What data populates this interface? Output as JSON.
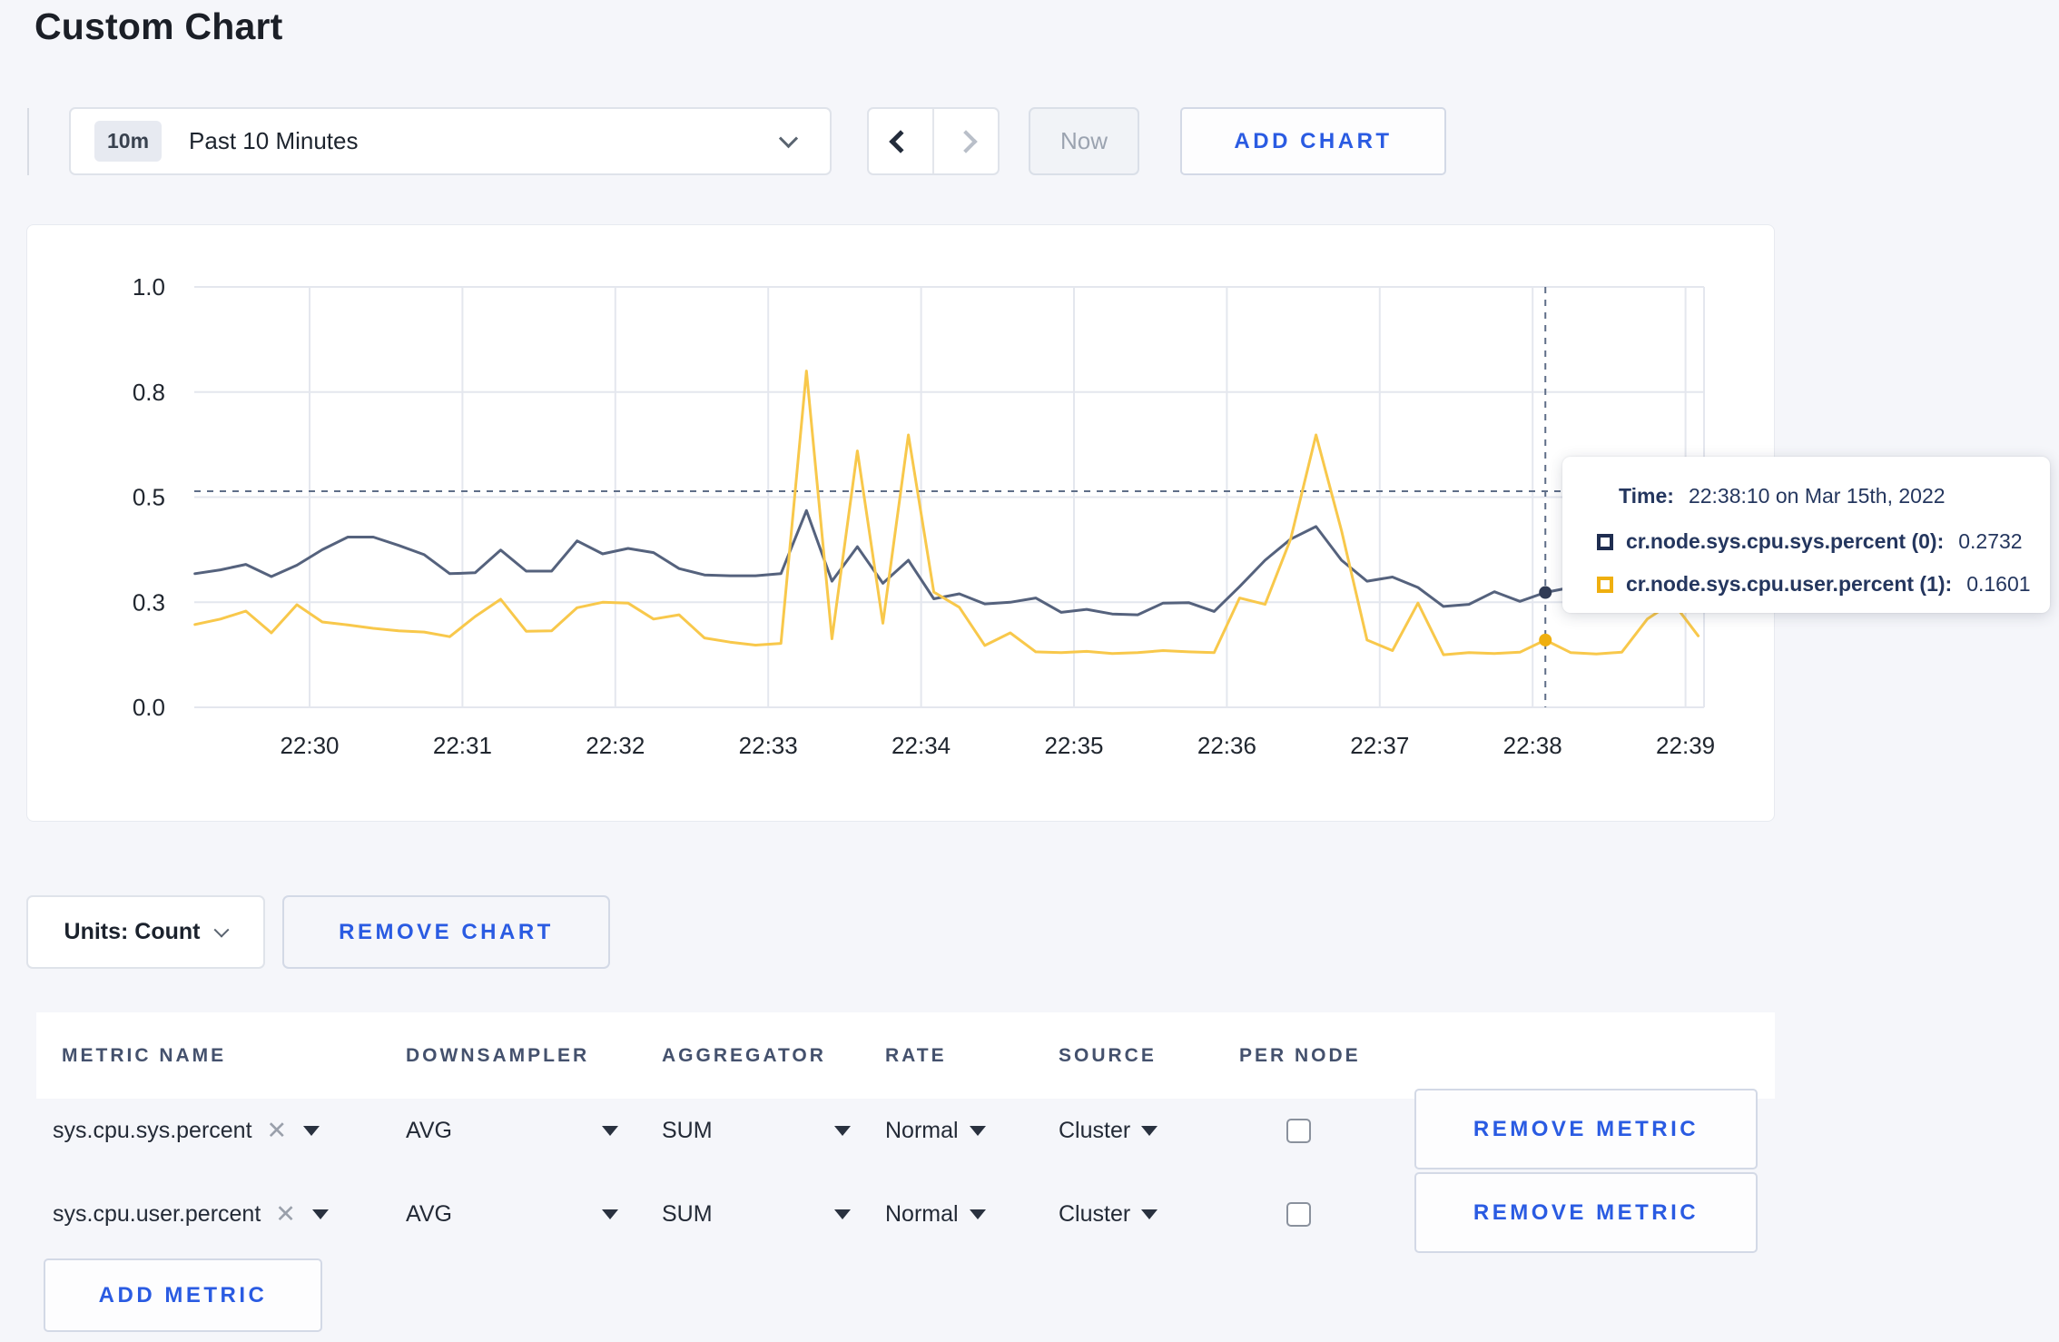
{
  "page": {
    "title": "Custom Chart"
  },
  "toolbar": {
    "time_window_badge": "10m",
    "time_window_label": "Past 10 Minutes",
    "prev_label": "previous time window",
    "next_label": "next time window",
    "now_label": "Now",
    "add_chart_label": "ADD CHART"
  },
  "chart_controls": {
    "units_label": "Units: Count",
    "remove_chart_label": "REMOVE CHART"
  },
  "tooltip": {
    "time_label": "Time:",
    "time_value": "22:38:10 on Mar 15th, 2022",
    "series": [
      {
        "name": "cr.node.sys.cpu.sys.percent (0):",
        "value": "0.2732",
        "color": "#1f2d50"
      },
      {
        "name": "cr.node.sys.cpu.user.percent (1):",
        "value": "0.1601",
        "color": "#efaf10"
      }
    ]
  },
  "metrics_table": {
    "headers": [
      "METRIC NAME",
      "DOWNSAMPLER",
      "AGGREGATOR",
      "RATE",
      "SOURCE",
      "PER NODE"
    ],
    "rows": [
      {
        "metric": "sys.cpu.sys.percent",
        "downsampler": "AVG",
        "aggregator": "SUM",
        "rate": "Normal",
        "source": "Cluster",
        "per_node": false,
        "remove_label": "REMOVE METRIC"
      },
      {
        "metric": "sys.cpu.user.percent",
        "downsampler": "AVG",
        "aggregator": "SUM",
        "rate": "Normal",
        "source": "Cluster",
        "per_node": false,
        "remove_label": "REMOVE METRIC"
      }
    ],
    "add_metric_label": "ADD METRIC"
  },
  "chart_data": {
    "type": "line",
    "x_ticks": [
      "22:30",
      "22:31",
      "22:32",
      "22:33",
      "22:34",
      "22:35",
      "22:36",
      "22:37",
      "22:38",
      "22:39"
    ],
    "y_ticks": [
      {
        "label": "1.0",
        "v": 1.0
      },
      {
        "label": "0.8",
        "v": 0.75
      },
      {
        "label": "0.5",
        "v": 0.5
      },
      {
        "label": "0.3",
        "v": 0.25
      },
      {
        "label": "0.0",
        "v": 0.0
      }
    ],
    "ylim": [
      0,
      1
    ],
    "start_time": "22:29:15",
    "start_offset_minutes": -0.75,
    "step_minutes": 0.166667,
    "grid": true,
    "series": [
      {
        "name": "cr.node.sys.cpu.sys.percent",
        "color": "#55627d",
        "dot_color": "#303b55",
        "values": [
          0.318,
          0.327,
          0.34,
          0.311,
          0.338,
          0.375,
          0.405,
          0.405,
          0.385,
          0.363,
          0.318,
          0.32,
          0.374,
          0.324,
          0.324,
          0.396,
          0.365,
          0.378,
          0.368,
          0.33,
          0.315,
          0.313,
          0.313,
          0.318,
          0.468,
          0.3,
          0.382,
          0.295,
          0.35,
          0.258,
          0.27,
          0.246,
          0.25,
          0.26,
          0.226,
          0.233,
          0.222,
          0.22,
          0.248,
          0.249,
          0.228,
          0.287,
          0.35,
          0.4,
          0.43,
          0.35,
          0.3,
          0.31,
          0.285,
          0.24,
          0.245,
          0.275,
          0.252,
          0.2732,
          0.285,
          0.29,
          0.285,
          0.29,
          0.285,
          0.29
        ]
      },
      {
        "name": "cr.node.sys.cpu.user.percent",
        "color": "#f8c84b",
        "dot_color": "#efaf10",
        "values": [
          0.197,
          0.21,
          0.229,
          0.177,
          0.244,
          0.203,
          0.196,
          0.188,
          0.182,
          0.179,
          0.168,
          0.216,
          0.257,
          0.181,
          0.182,
          0.237,
          0.25,
          0.248,
          0.21,
          0.22,
          0.165,
          0.155,
          0.148,
          0.152,
          0.8,
          0.163,
          0.61,
          0.2,
          0.648,
          0.274,
          0.238,
          0.147,
          0.177,
          0.132,
          0.13,
          0.133,
          0.128,
          0.13,
          0.135,
          0.132,
          0.13,
          0.26,
          0.245,
          0.4,
          0.648,
          0.42,
          0.16,
          0.135,
          0.248,
          0.125,
          0.13,
          0.128,
          0.131,
          0.1601,
          0.13,
          0.127,
          0.131,
          0.21,
          0.25,
          0.17
        ]
      }
    ],
    "crosshair": {
      "index": 53,
      "time": "22:38:10",
      "y_value": 0.514
    },
    "legend_position": "tooltip"
  }
}
